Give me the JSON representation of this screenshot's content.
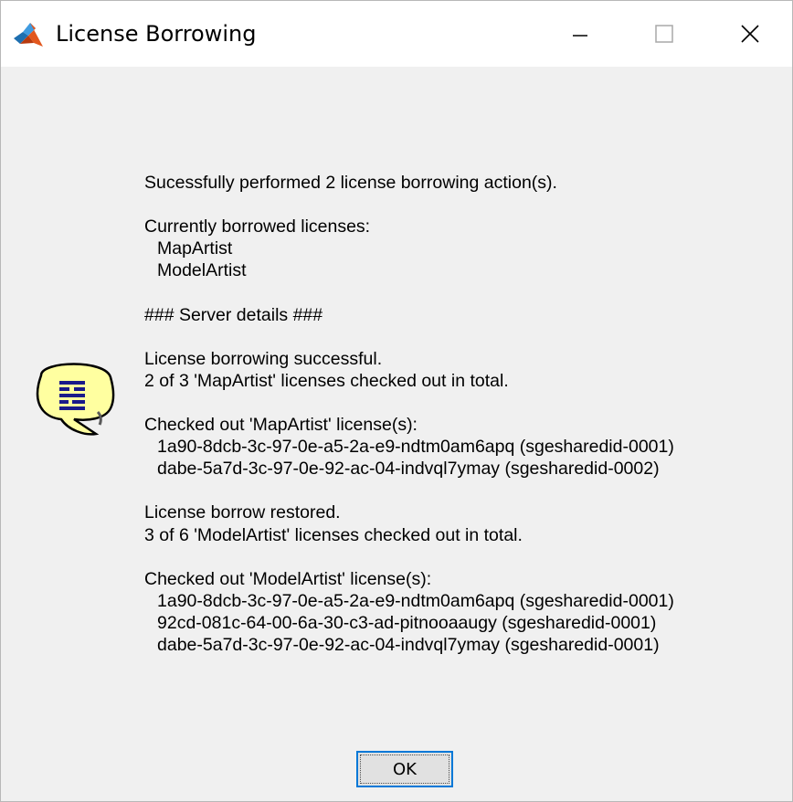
{
  "window": {
    "title": "License Borrowing",
    "icons": {
      "app": "matlab-icon",
      "minimize": "minimize-icon",
      "maximize": "maximize-icon",
      "close": "close-icon",
      "message": "speech-bubble-info-icon"
    },
    "colors": {
      "titlebar": "#ffffff",
      "body": "#f0f0f0",
      "button_border": "#0078d7",
      "bubble_fill": "#ffffa0",
      "bubble_glyph": "#1a1a8a"
    }
  },
  "message": {
    "summary": "Sucessfully performed 2 license borrowing action(s).",
    "borrowed_heading": "Currently borrowed licenses:",
    "borrowed": [
      "MapArtist",
      "ModelArtist"
    ],
    "server_heading": "### Server details ###",
    "sections": [
      {
        "status": "License borrowing successful.",
        "count": "2 of 3 'MapArtist' licenses checked out in total.",
        "checked_heading": "Checked out 'MapArtist' license(s):",
        "licenses": [
          "1a90-8dcb-3c-97-0e-a5-2a-e9-ndtm0am6apq (sgesharedid-0001)",
          "dabe-5a7d-3c-97-0e-92-ac-04-indvql7ymay (sgesharedid-0002)"
        ]
      },
      {
        "status": "License borrow restored.",
        "count": "3 of 6 'ModelArtist' licenses checked out in total.",
        "checked_heading": "Checked out 'ModelArtist' license(s):",
        "licenses": [
          "1a90-8dcb-3c-97-0e-a5-2a-e9-ndtm0am6apq (sgesharedid-0001)",
          "92cd-081c-64-00-6a-30-c3-ad-pitnooaaugy (sgesharedid-0001)",
          "dabe-5a7d-3c-97-0e-92-ac-04-indvql7ymay (sgesharedid-0001)"
        ]
      }
    ]
  },
  "buttons": {
    "ok_label": "OK"
  }
}
